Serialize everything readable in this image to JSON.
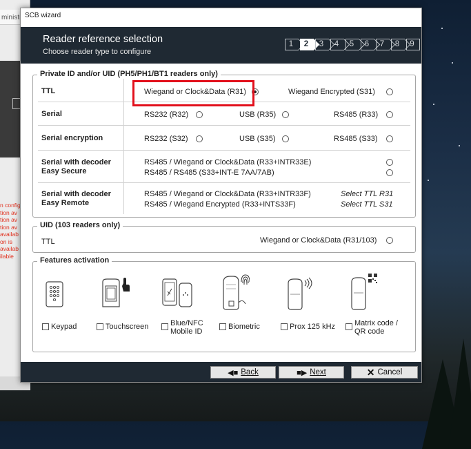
{
  "background_app": {
    "title": "ministra",
    "warnings": [
      "n config",
      "tion av",
      "tion av",
      "tion av",
      "availab",
      "on is",
      "availab",
      "ilable"
    ]
  },
  "window": {
    "title": "SCB wizard"
  },
  "header": {
    "title": "Reader reference selection",
    "subtitle": "Choose reader type to configure",
    "steps": [
      "1",
      "2",
      "3",
      "4",
      "5",
      "6",
      "7",
      "8",
      "9"
    ],
    "active_step": 2
  },
  "private_group": {
    "legend": "Private ID and/or UID (PH5/PH1/BT1 readers only)",
    "ttl": {
      "label": "TTL",
      "opt1": "Wiegand or Clock&Data (R31)",
      "opt2": "Wiegand Encrypted (S31)",
      "selected": "opt1"
    },
    "serial": {
      "label": "Serial",
      "opt1": "RS232 (R32)",
      "opt2": "USB (R35)",
      "opt3": "RS485 (R33)"
    },
    "serial_enc": {
      "label": "Serial encryption",
      "opt1": "RS232 (S32)",
      "opt2": "USB (S35)",
      "opt3": "RS485 (S33)"
    },
    "decoder_secure": {
      "label1": "Serial with decoder",
      "label2": "Easy Secure",
      "opt1": "RS485 / Wiegand or Clock&Data (R33+INTR33E)",
      "opt2": "RS485 / RS485 (S33+INT-E 7AA/7AB)"
    },
    "decoder_remote": {
      "label1": "Serial with decoder",
      "label2": "Easy Remote",
      "opt1": "RS485 / Wiegand or Clock&Data (R33+INTR33F)",
      "opt2": "RS485 / Wiegand Encrypted (R33+INTS33F)",
      "note1": "Select TTL R31",
      "note2": "Select TTL S31"
    }
  },
  "uid_group": {
    "legend": "UID (103 readers only)",
    "label": "TTL",
    "opt": "Wiegand or Clock&Data (R31/103)"
  },
  "features": {
    "legend": "Features activation",
    "items": [
      {
        "line1": "Keypad",
        "line2": "",
        "icon": "keypad-icon"
      },
      {
        "line1": "Touchscreen",
        "line2": "",
        "icon": "touchscreen-icon"
      },
      {
        "line1": "Blue/NFC",
        "line2": "Mobile ID",
        "icon": "phone-nfc-icon"
      },
      {
        "line1": "Biometric",
        "line2": "",
        "icon": "fingerprint-icon"
      },
      {
        "line1": "Prox 125 kHz",
        "line2": "",
        "icon": "prox-icon"
      },
      {
        "line1": "Matrix code /",
        "line2": "QR code",
        "icon": "qr-code-icon"
      }
    ]
  },
  "footer": {
    "back": "Back",
    "next": "Next",
    "cancel": "Cancel"
  },
  "colors": {
    "header_bg": "#1f2933",
    "highlight": "#e2101c"
  }
}
